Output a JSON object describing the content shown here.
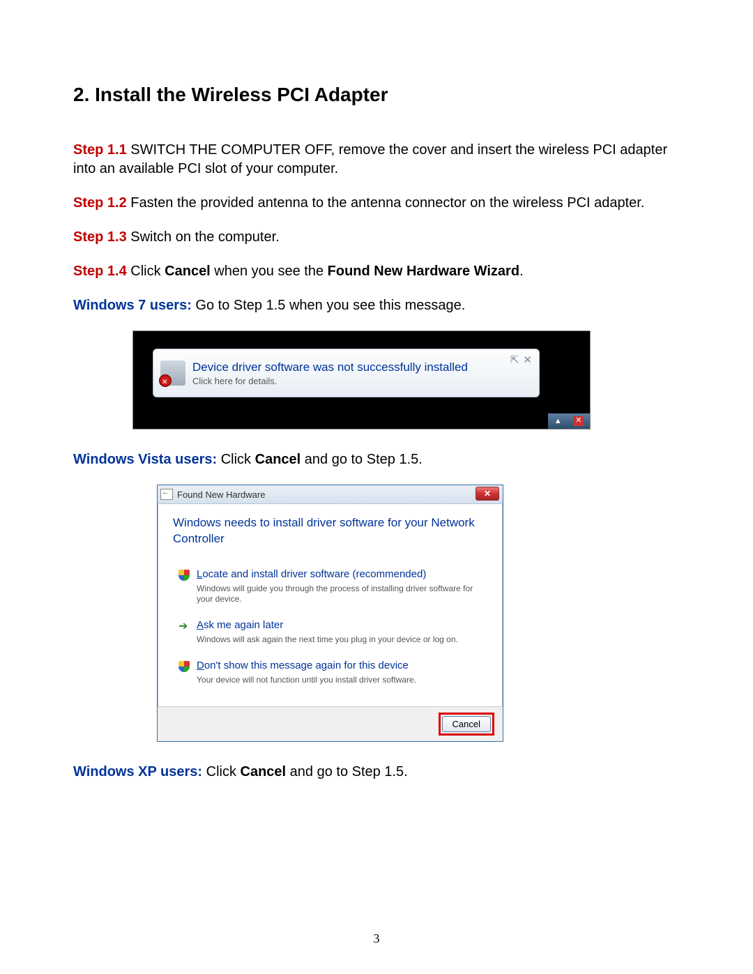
{
  "heading": "2. Install the Wireless PCI Adapter",
  "steps": {
    "s1": {
      "label": "Step 1.1",
      "text": " SWITCH THE COMPUTER OFF, remove the cover and insert the wireless PCI adapter into an available PCI slot of your computer."
    },
    "s2": {
      "label": "Step 1.2",
      "text": " Fasten the provided antenna to the antenna connector on the wireless PCI adapter."
    },
    "s3": {
      "label": "Step 1.3",
      "text": " Switch on the computer."
    },
    "s4": {
      "label": "Step 1.4",
      "pre": " Click ",
      "b1": "Cancel",
      "mid": " when you see the ",
      "b2": "Found New Hardware Wizard",
      "post": "."
    }
  },
  "win7": {
    "label": "Windows 7 users:",
    "text": " Go to Step 1.5 when you see this message.",
    "balloon_title": "Device driver software was not successfully installed",
    "balloon_sub": "Click here for details."
  },
  "vista": {
    "label": "Windows Vista users:",
    "pre": " Click ",
    "b1": "Cancel",
    "post": " and go to Step 1.5.",
    "title": "Found New Hardware",
    "heading": "Windows needs to install driver software for your Network Controller",
    "opt1_title_pre": "L",
    "opt1_title": "ocate and install driver software (recommended)",
    "opt1_desc": "Windows will guide you through the process of installing driver software for your device.",
    "opt2_title_pre": "A",
    "opt2_title": "sk me again later",
    "opt2_desc": "Windows will ask again the next time you plug in your device or log on.",
    "opt3_title_pre": "D",
    "opt3_title": "on't show this message again for this device",
    "opt3_desc": "Your device will not function until you install driver software.",
    "cancel": "Cancel"
  },
  "xp": {
    "label": "Windows XP users:",
    "pre": " Click ",
    "b1": "Cancel",
    "post": " and go to Step 1.5."
  },
  "page_number": "3"
}
